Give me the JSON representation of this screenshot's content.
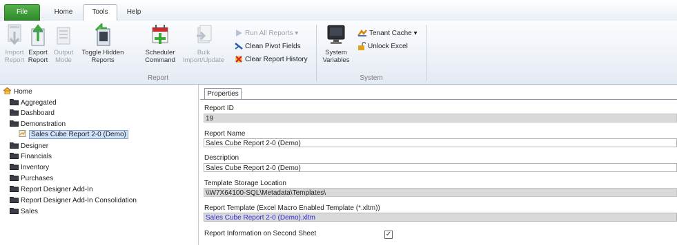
{
  "tabs": [
    "File",
    "Home",
    "Tools",
    "Help"
  ],
  "ribbon": {
    "report_group": {
      "label": "Report",
      "buttons": [
        {
          "line1": "Import",
          "line2": "Report",
          "icon": "import-report-icon",
          "enabled": false
        },
        {
          "line1": "Export",
          "line2": "Report",
          "icon": "export-report-icon",
          "enabled": true
        },
        {
          "line1": "Output",
          "line2": "Mode",
          "icon": "output-mode-icon",
          "enabled": false
        },
        {
          "line1": "Toggle Hidden",
          "line2": "Reports",
          "icon": "toggle-hidden-icon",
          "enabled": true
        },
        {
          "line1": "Scheduler",
          "line2": "Command",
          "icon": "scheduler-command-icon",
          "enabled": true
        },
        {
          "line1": "Bulk",
          "line2": "Import/Update",
          "icon": "bulk-import-icon",
          "enabled": false
        }
      ],
      "small_buttons": [
        {
          "label": "Run All Reports",
          "icon": "play-icon",
          "enabled": false
        },
        {
          "label": "Clean Pivot Fields",
          "icon": "clean-icon",
          "enabled": true
        },
        {
          "label": "Clear Report History",
          "icon": "clear-history-icon",
          "enabled": true
        }
      ]
    },
    "system_group": {
      "label": "System",
      "variables": {
        "line1": "System",
        "line2": "Variables",
        "icon": "system-variables-icon"
      },
      "tenant_cache": "Tenant Cache",
      "unlock_excel": "Unlock Excel"
    }
  },
  "tree": {
    "root": "Home",
    "items": [
      {
        "label": "Aggregated"
      },
      {
        "label": "Dashboard"
      },
      {
        "label": "Demonstration"
      },
      {
        "label": "Sales Cube Report 2-0 (Demo)",
        "selected": true
      },
      {
        "label": "Designer"
      },
      {
        "label": "Financials"
      },
      {
        "label": "Inventory"
      },
      {
        "label": "Purchases"
      },
      {
        "label": "Report Designer Add-In"
      },
      {
        "label": "Report Designer Add-In Consolidation"
      },
      {
        "label": "Sales"
      }
    ]
  },
  "properties": {
    "tab": "Properties",
    "report_id_label": "Report ID",
    "report_id": "19",
    "report_name_label": "Report Name",
    "report_name": "Sales Cube Report 2-0 (Demo)",
    "description_label": "Description",
    "description": "Sales Cube Report 2-0 (Demo)",
    "template_location_label": "Template Storage Location",
    "template_location": "\\\\W7X64100-SQL\\Metadata\\Templates\\",
    "report_template_label": "Report Template (Excel Macro Enabled Template (*.xltm))",
    "report_template": "Sales Cube Report 2-0 (Demo).xltm",
    "second_sheet_label": "Report Information on Second Sheet",
    "second_sheet_checked": "✓"
  },
  "colors": {
    "file_tab": "#3c9a38",
    "link": "#2a2ad6",
    "selection": "#cfe3fb",
    "readonly": "#d9d9d9"
  }
}
